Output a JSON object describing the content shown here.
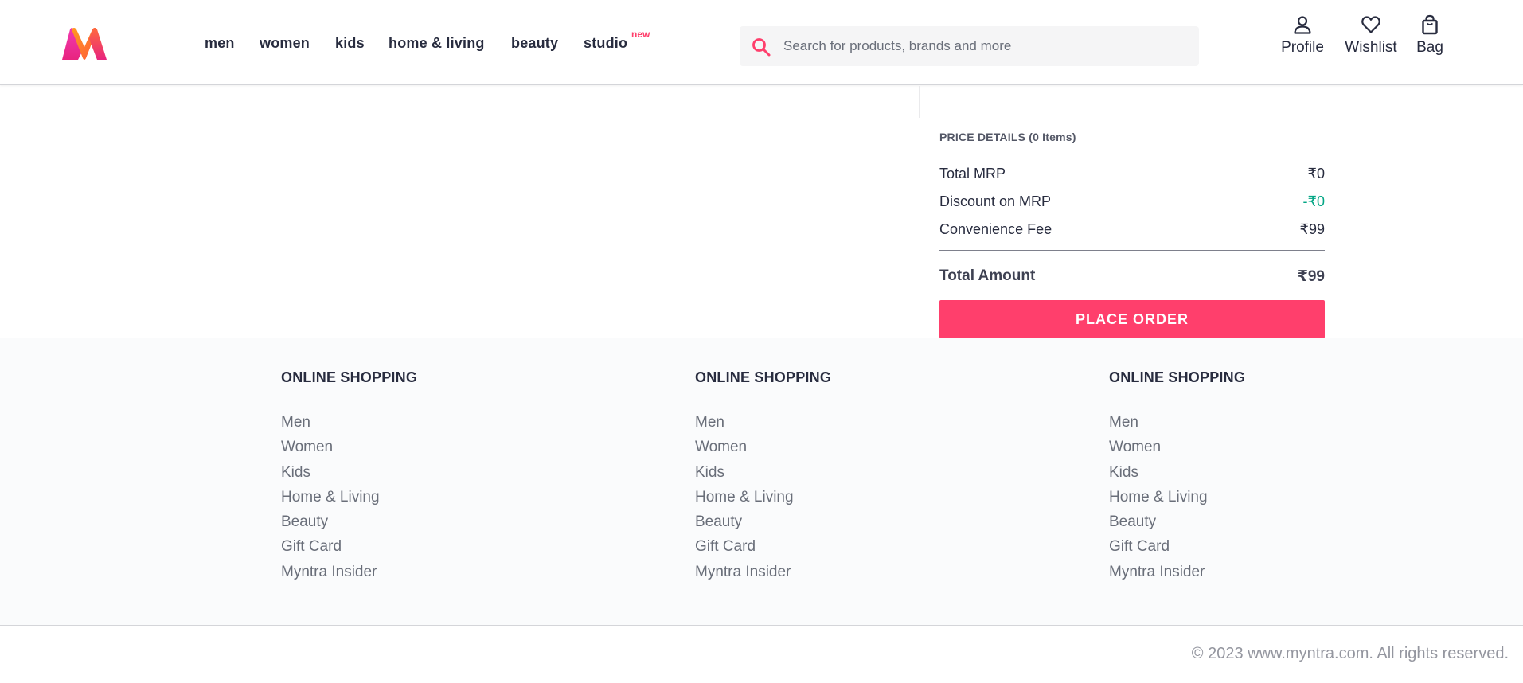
{
  "header": {
    "logo": "myntra-logo",
    "nav": [
      {
        "label": "men"
      },
      {
        "label": "women"
      },
      {
        "label": "kids"
      },
      {
        "label": "home & living"
      },
      {
        "label": "beauty"
      },
      {
        "label": "studio",
        "badge": "new"
      }
    ],
    "search": {
      "placeholder": "Search for products, brands and more",
      "value": "",
      "icon": "search-icon"
    },
    "actions": [
      {
        "label": "Profile",
        "icon": "profile-icon"
      },
      {
        "label": "Wishlist",
        "icon": "heart-icon"
      },
      {
        "label": "Bag",
        "icon": "bag-icon"
      }
    ]
  },
  "price_details": {
    "heading": "PRICE DETAILS (0 Items)",
    "rows": [
      {
        "label": "Total MRP",
        "value": "₹0"
      },
      {
        "label": "Discount on MRP",
        "value": "-₹0"
      },
      {
        "label": "Convenience Fee",
        "value": "₹99"
      }
    ],
    "total": {
      "label": "Total Amount",
      "value": "₹99"
    },
    "place_order": "PLACE ORDER"
  },
  "footer": {
    "columns": [
      {
        "title": "ONLINE SHOPPING",
        "links": [
          "Men",
          "Women",
          "Kids",
          "Home & Living",
          "Beauty",
          "Gift Card",
          "Myntra Insider"
        ]
      },
      {
        "title": "ONLINE SHOPPING",
        "links": [
          "Men",
          "Women",
          "Kids",
          "Home & Living",
          "Beauty",
          "Gift Card",
          "Myntra Insider"
        ]
      },
      {
        "title": "ONLINE SHOPPING",
        "links": [
          "Men",
          "Women",
          "Kids",
          "Home & Living",
          "Beauty",
          "Gift Card",
          "Myntra Insider"
        ]
      }
    ],
    "copyright": "© 2023 www.myntra.com. All rights reserved."
  },
  "colors": {
    "brand_pink": "#ff3f6c",
    "discount_green": "#03a685",
    "text_dark": "#282c3f",
    "text_muted": "#696e79"
  }
}
